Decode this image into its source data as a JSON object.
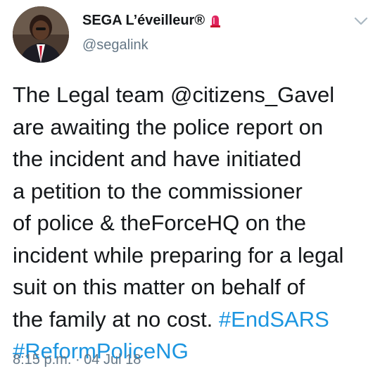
{
  "user": {
    "display_name": "SEGA L’éveilleur®",
    "handle": "@segalink",
    "badge_icon": "siren-icon",
    "avatar_icon": "profile-photo"
  },
  "menu": {
    "icon": "chevron-down-icon"
  },
  "tweet": {
    "lines": [
      "The Legal team @citizens_Gavel",
      "are awaiting the police report on",
      "the incident and have initiated",
      "a petition to the commissioner",
      "of police & theForceHQ on the",
      "incident while preparing for a legal",
      "suit on this matter on behalf of",
      "the family at no cost."
    ],
    "hashtags": [
      "#EndSARS",
      "#ReformPoliceNG"
    ]
  },
  "meta": {
    "time": "8:15 p.m.",
    "separator": " · ",
    "date": "04 Jul 18"
  },
  "colors": {
    "text": "#14171a",
    "muted": "#657786",
    "link": "#1b95e0",
    "badge": "#e0245e"
  }
}
